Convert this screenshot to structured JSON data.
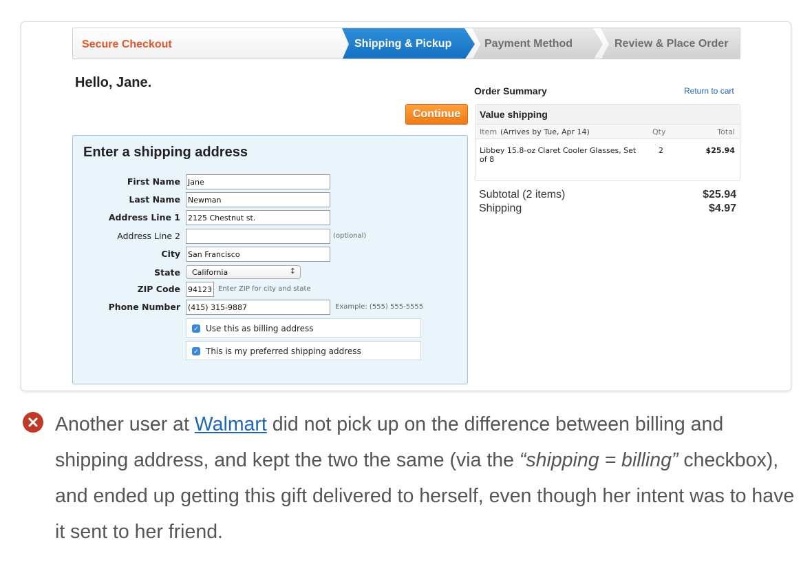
{
  "checkout": {
    "secure_label": "Secure Checkout",
    "steps": [
      "Shipping & Pickup",
      "Payment Method",
      "Review & Place Order"
    ],
    "active_step_color": "#1f7fcf",
    "greeting": "Hello, Jane.",
    "continue_label": "Continue",
    "form": {
      "title": "Enter a shipping address",
      "first_name": {
        "label": "First Name",
        "value": "Jane"
      },
      "last_name": {
        "label": "Last Name",
        "value": "Newman"
      },
      "address1": {
        "label": "Address Line 1",
        "value": "2125 Chestnut st."
      },
      "address2": {
        "label": "Address Line 2",
        "value": "",
        "hint": "(optional)"
      },
      "city": {
        "label": "City",
        "value": "San Francisco"
      },
      "state": {
        "label": "State",
        "value": "California"
      },
      "zip": {
        "label": "ZIP Code",
        "value": "94123",
        "hint": "Enter ZIP for city and state"
      },
      "phone": {
        "label": "Phone Number",
        "value": "(415) 315-9887",
        "hint": "Example: (555) 555-5555"
      },
      "billing_checkbox": {
        "label": "Use this as billing address",
        "checked": true
      },
      "preferred_checkbox": {
        "label": "This is my preferred shipping address",
        "checked": true
      }
    },
    "summary": {
      "title": "Order Summary",
      "return_link": "Return to cart",
      "shipping_type": "Value shipping",
      "col_item": "Item",
      "col_arrives": "(Arrives by Tue, Apr 14)",
      "col_qty": "Qty",
      "col_total": "Total",
      "item_name": "Libbey 15.8-oz Claret Cooler Glasses, Set of 8",
      "item_qty": "2",
      "item_total": "$25.94",
      "subtotal_label": "Subtotal (2 items)",
      "subtotal_value": "$25.94",
      "shipping_label": "Shipping",
      "shipping_value": "$4.97"
    }
  },
  "caption": {
    "text_1": "Another user at ",
    "link": "Walmart",
    "text_2": " did not pick up on the difference between billing and shipping address, and kept the two the same (via the ",
    "emphasis": "“shipping = billing”",
    "text_3": " checkbox), and ended up getting this gift delivered to herself, even though her intent was to have it sent to her friend.",
    "icon": "error-x-icon",
    "icon_color": "#c0392b"
  }
}
